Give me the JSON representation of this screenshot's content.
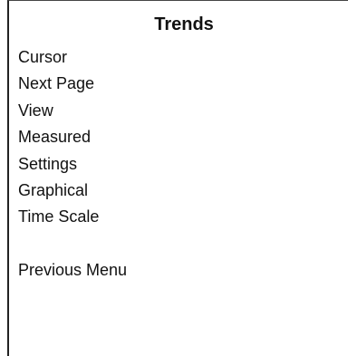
{
  "menu": {
    "title": "Trends",
    "items": [
      "Cursor",
      "Next Page",
      "View",
      "Measured",
      "Settings",
      "Graphical",
      "Time Scale"
    ],
    "back_label": "Previous Menu"
  }
}
